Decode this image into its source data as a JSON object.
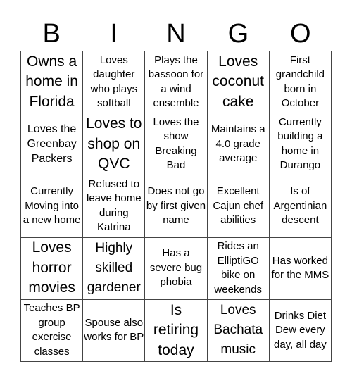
{
  "header": {
    "letters": [
      "B",
      "I",
      "N",
      "G",
      "O"
    ]
  },
  "cells": [
    "Owns a home in Florida",
    "Loves daughter who plays softball",
    "Plays the bassoon for a wind ensemble",
    "Loves coconut cake",
    "First grandchild born in October",
    "Loves the Greenbay Packers",
    "Loves to shop on QVC",
    "Loves the show Breaking Bad",
    "Maintains a 4.0 grade average",
    "Currently building a home in Durango",
    "Currently Moving into a new home",
    "Refused to leave home during Katrina",
    "Does not go by first given name",
    "Excellent Cajun chef abilities",
    "Is of Argentinian descent",
    "Loves horror movies",
    "Highly skilled gardener",
    "Has a severe bug phobia",
    "Rides an ElliptiGO bike on weekends",
    "Has worked for the MMS",
    "Teaches BP group exercise classes",
    "Spouse also works for BP",
    "Is retiring today",
    "Loves Bachata music",
    "Drinks Diet Dew every day, all day"
  ]
}
